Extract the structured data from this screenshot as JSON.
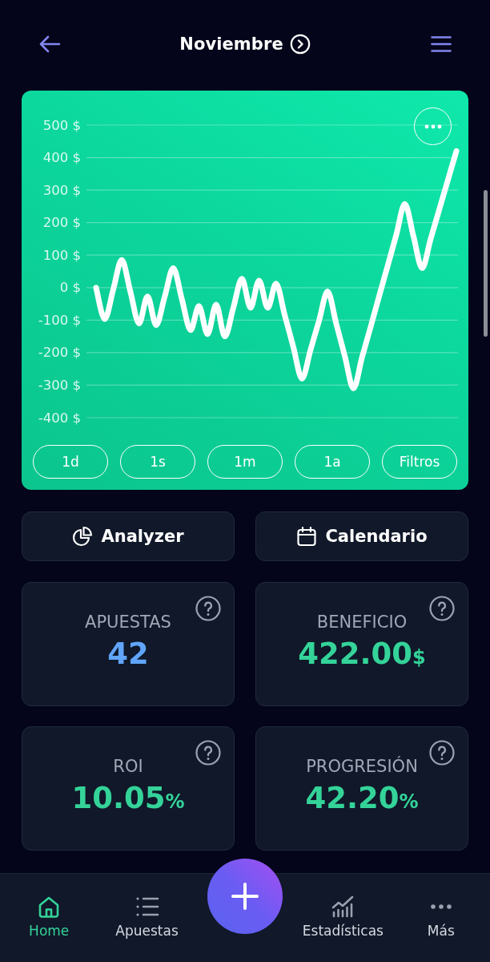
{
  "header": {
    "title": "Noviembre"
  },
  "chart": {
    "chart_data": {
      "type": "line",
      "categories": [
        null,
        null,
        null,
        null,
        null,
        null,
        null,
        null,
        null,
        null,
        null,
        null,
        null,
        null,
        null,
        null,
        null,
        null,
        null,
        null,
        null,
        null,
        null,
        null,
        null,
        null,
        null,
        null,
        null,
        null,
        null,
        null,
        null,
        null,
        null,
        null,
        null,
        null,
        null,
        null,
        null,
        null,
        null
      ],
      "values": [
        0,
        -97,
        -6,
        85,
        -13,
        -110,
        -27,
        -115,
        -28,
        60,
        -35,
        -130,
        -57,
        -143,
        -52,
        -150,
        -62,
        27,
        -62,
        22,
        -62,
        12,
        -85,
        -183,
        -280,
        -191,
        -101,
        -12,
        -111,
        -211,
        -310,
        -215,
        -121,
        -26,
        68,
        163,
        257,
        158,
        60,
        150,
        240,
        330,
        420
      ],
      "ylim": [
        -400,
        500
      ],
      "yticks": [
        {
          "value": 500,
          "label": "500 $"
        },
        {
          "value": 400,
          "label": "400 $"
        },
        {
          "value": 300,
          "label": "300 $"
        },
        {
          "value": 200,
          "label": "200 $"
        },
        {
          "value": 100,
          "label": "100 $"
        },
        {
          "value": 0,
          "label": "0 $"
        },
        {
          "value": -100,
          "label": "-100 $"
        },
        {
          "value": -200,
          "label": "-200 $"
        },
        {
          "value": -300,
          "label": "-300 $"
        },
        {
          "value": -400,
          "label": "-400 $"
        }
      ],
      "grid": true
    },
    "range_buttons": [
      {
        "label": "1d",
        "selected": false
      },
      {
        "label": "1s",
        "selected": false
      },
      {
        "label": "1m",
        "selected": false
      },
      {
        "label": "1a",
        "selected": false
      }
    ],
    "filter_button": {
      "label": "Filtros"
    }
  },
  "actions": [
    {
      "label": "Analyzer"
    },
    {
      "label": "Calendario"
    }
  ],
  "stats": [
    {
      "label": "APUESTAS",
      "value": "42",
      "color": "#60a5fa"
    },
    {
      "label": "BENEFICIO",
      "value": "422.00",
      "unit": "$",
      "color": "#34d399"
    },
    {
      "label": "ROI",
      "value": "10.05",
      "unit": "%",
      "color": "#34d399"
    },
    {
      "label": "PROGRESIÓN",
      "value": "42.20",
      "unit": "%",
      "color": "#34d399"
    }
  ],
  "nav": [
    {
      "label": "Home",
      "selected": true
    },
    {
      "label": "Apuestas",
      "selected": false
    },
    {
      "label": "Estadísticas",
      "selected": false
    },
    {
      "label": "Más",
      "selected": false
    }
  ]
}
